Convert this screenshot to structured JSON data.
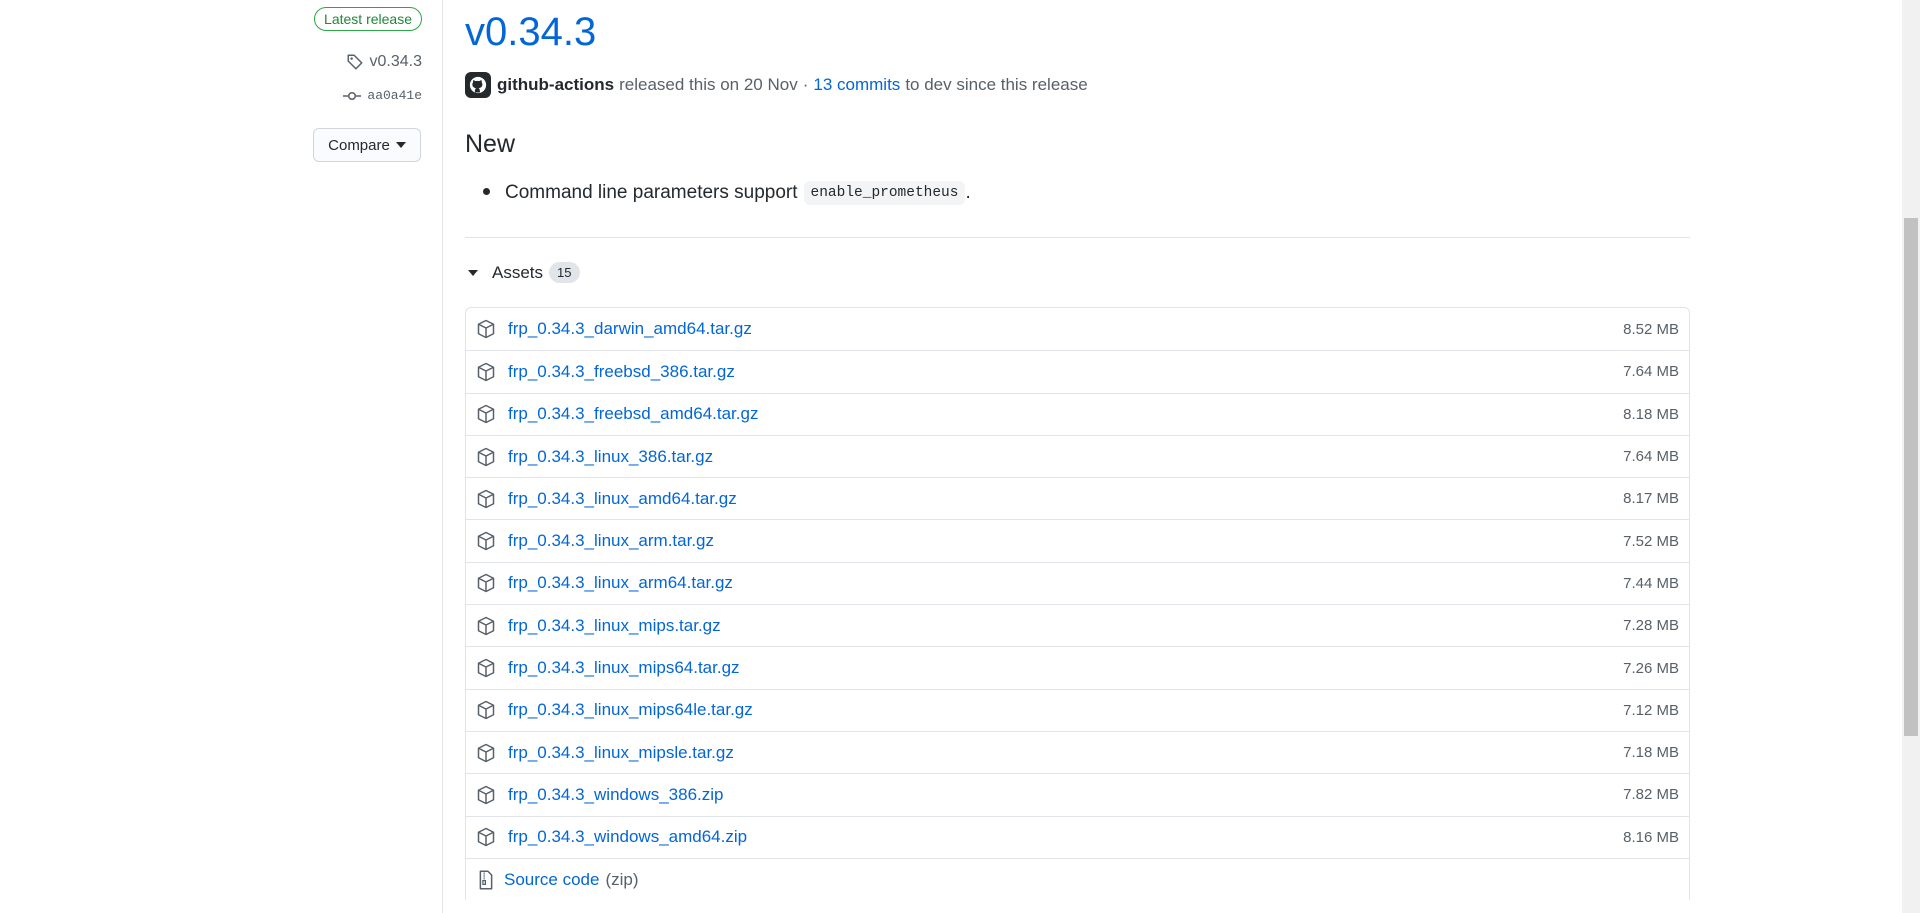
{
  "sidebar": {
    "latest_badge": "Latest release",
    "tag": "v0.34.3",
    "commit": "aa0a41e",
    "compare_label": "Compare"
  },
  "release": {
    "title": "v0.34.3",
    "author": "github-actions",
    "released_text": "released this on 20 Nov",
    "separator": "·",
    "commits_link": "13 commits",
    "since_text": "to dev since this release",
    "section_heading": "New",
    "note_text": "Command line parameters support",
    "note_code": "enable_prometheus",
    "note_end": "."
  },
  "assets": {
    "label": "Assets",
    "count": "15",
    "items": [
      {
        "name": "frp_0.34.3_darwin_amd64.tar.gz",
        "size": "8.52 MB"
      },
      {
        "name": "frp_0.34.3_freebsd_386.tar.gz",
        "size": "7.64 MB"
      },
      {
        "name": "frp_0.34.3_freebsd_amd64.tar.gz",
        "size": "8.18 MB"
      },
      {
        "name": "frp_0.34.3_linux_386.tar.gz",
        "size": "7.64 MB"
      },
      {
        "name": "frp_0.34.3_linux_amd64.tar.gz",
        "size": "8.17 MB"
      },
      {
        "name": "frp_0.34.3_linux_arm.tar.gz",
        "size": "7.52 MB"
      },
      {
        "name": "frp_0.34.3_linux_arm64.tar.gz",
        "size": "7.44 MB"
      },
      {
        "name": "frp_0.34.3_linux_mips.tar.gz",
        "size": "7.28 MB"
      },
      {
        "name": "frp_0.34.3_linux_mips64.tar.gz",
        "size": "7.26 MB"
      },
      {
        "name": "frp_0.34.3_linux_mips64le.tar.gz",
        "size": "7.12 MB"
      },
      {
        "name": "frp_0.34.3_linux_mipsle.tar.gz",
        "size": "7.18 MB"
      },
      {
        "name": "frp_0.34.3_windows_386.zip",
        "size": "7.82 MB"
      },
      {
        "name": "frp_0.34.3_windows_amd64.zip",
        "size": "8.16 MB"
      }
    ],
    "source_label": "Source code",
    "source_format": "(zip)"
  },
  "icons": {
    "tag": "tag-icon",
    "commit": "git-commit-icon",
    "package": "package-icon",
    "zip": "file-zip-icon",
    "avatar": "github-avatar-icon"
  },
  "colors": {
    "link": "#0366d6",
    "success": "#28a745",
    "muted": "#586069",
    "border": "#e1e4e8"
  }
}
